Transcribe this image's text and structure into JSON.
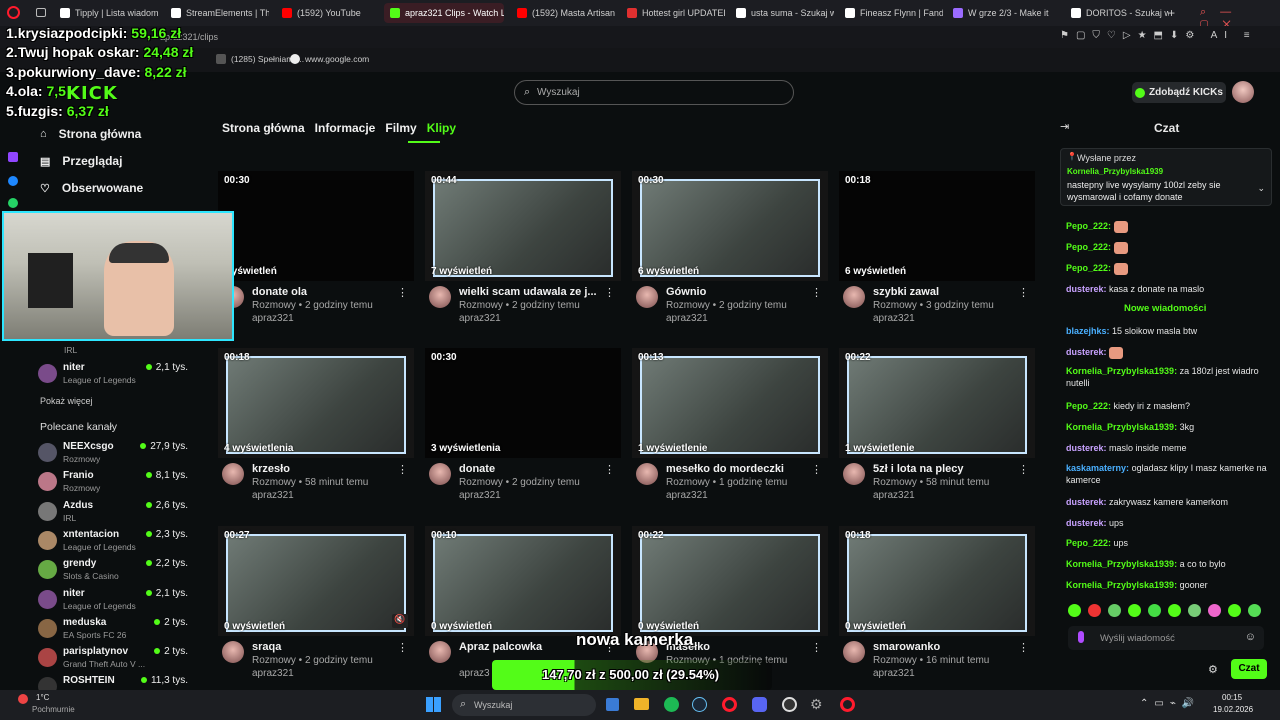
{
  "browser": {
    "tabs": [
      {
        "label": "Tipply | Lista wiadom",
        "color": "#ffffff"
      },
      {
        "label": "StreamElements | Th",
        "color": "#ffffff"
      },
      {
        "label": "(1592) YouTube",
        "color": "#ff0000"
      },
      {
        "label": "apraz321 Clips - Watch Li",
        "color": "#53fc18",
        "active": true
      },
      {
        "label": "(1592) Masta Artisan",
        "color": "#ff0000"
      },
      {
        "label": "Hottest girl UPDATED",
        "color": "#e03030"
      },
      {
        "label": "usta suma - Szukaj w",
        "color": "#ffffff"
      },
      {
        "label": "Fineasz Flynn | Fand",
        "color": "#ffffff"
      },
      {
        "label": "W grze 2/3 - Make it",
        "color": "#9b6bff"
      },
      {
        "label": "DORITOS - Szukaj w",
        "color": "#ffffff"
      }
    ],
    "address_fragment": "apraz321/clips",
    "bookmarks": [
      "(1285) Spełniamy...",
      "www.google.com"
    ]
  },
  "stream_overlay": {
    "leaderboard": [
      {
        "rank": "1.",
        "name": "krysiazpodcipki:",
        "amount": "59,16 zł"
      },
      {
        "rank": "2.",
        "name": "Twuj hopak oskar:",
        "amount": "24,48 zł"
      },
      {
        "rank": "3.",
        "name": "pokurwiony_dave:",
        "amount": "8,22 zł"
      },
      {
        "rank": "4.",
        "name": "ola:",
        "amount": "7,5"
      },
      {
        "rank": "5.",
        "name": "fuzgis:",
        "amount": "6,37 zł"
      }
    ],
    "logo": "KICK",
    "camera_label": "nowa kamerka",
    "goal_text": "147,70 zł z 500,00 zł (29.54%)",
    "goal_fraction": 0.2954
  },
  "header": {
    "search_placeholder": "Wyszukaj",
    "kicks_button": "Zdobądź KICKs"
  },
  "sidebar": {
    "nav": [
      {
        "label": "Strona główna",
        "icon": "home-icon"
      },
      {
        "label": "Przeglądaj",
        "icon": "browse-icon"
      },
      {
        "label": "Obserwowane",
        "icon": "heart-icon"
      }
    ],
    "followed": [
      {
        "name": "niter",
        "category": "League of Legends",
        "viewers": "2,1 tys."
      }
    ],
    "followed_tag": "IRL",
    "show_more": "Pokaż więcej",
    "recommended_title": "Polecane kanały",
    "recommended": [
      {
        "name": "NEEXcsgo",
        "category": "Rozmowy",
        "viewers": "27,9 tys."
      },
      {
        "name": "Franio",
        "category": "Rozmowy",
        "viewers": "8,1 tys."
      },
      {
        "name": "Azdus",
        "category": "IRL",
        "viewers": "2,6 tys."
      },
      {
        "name": "xntentacion",
        "category": "League of Legends",
        "viewers": "2,3 tys."
      },
      {
        "name": "grendy",
        "category": "Slots & Casino",
        "viewers": "2,2 tys."
      },
      {
        "name": "niter",
        "category": "League of Legends",
        "viewers": "2,1 tys."
      },
      {
        "name": "meduska",
        "category": "EA Sports FC 26",
        "viewers": "2 tys."
      },
      {
        "name": "parisplatynov",
        "category": "Grand Theft Auto V ...",
        "viewers": "2 tys."
      },
      {
        "name": "ROSHTEIN",
        "category": "",
        "viewers": "11,3 tys."
      }
    ]
  },
  "channel_tabs": [
    {
      "label": "Strona główna"
    },
    {
      "label": "Informacje"
    },
    {
      "label": "Filmy"
    },
    {
      "label": "Klipy",
      "active": true
    }
  ],
  "clips": [
    {
      "duration": "00:30",
      "views": "wyświetleń",
      "title": "donate ola",
      "category": "Rozmowy",
      "time": "2 godziny temu",
      "channel": "apraz321",
      "dark": true
    },
    {
      "duration": "00:44",
      "views": "7 wyświetleń",
      "title": "wielki scam udawala ze j...",
      "category": "Rozmowy",
      "time": "2 godziny temu",
      "channel": "apraz321"
    },
    {
      "duration": "00:30",
      "views": "6 wyświetleń",
      "title": "Gównio",
      "category": "Rozmowy",
      "time": "2 godziny temu",
      "channel": "apraz321"
    },
    {
      "duration": "00:18",
      "views": "6 wyświetleń",
      "title": "szybki zawal",
      "category": "Rozmowy",
      "time": "3 godziny temu",
      "channel": "apraz321",
      "dark": true
    },
    {
      "duration": "00:18",
      "views": "4 wyświetlenia",
      "title": "krzesło",
      "category": "Rozmowy",
      "time": "58 minut temu",
      "channel": "apraz321"
    },
    {
      "duration": "00:30",
      "views": "3 wyświetlenia",
      "title": "donate",
      "category": "Rozmowy",
      "time": "2 godziny temu",
      "channel": "apraz321",
      "dark": true
    },
    {
      "duration": "00:13",
      "views": "1 wyświetlenie",
      "title": "mesełko do mordeczki",
      "category": "Rozmowy",
      "time": "1 godzinę temu",
      "channel": "apraz321"
    },
    {
      "duration": "00:22",
      "views": "1 wyświetlenie",
      "title": "5zł i lota na plecy",
      "category": "Rozmowy",
      "time": "58 minut temu",
      "channel": "apraz321"
    },
    {
      "duration": "00:27",
      "views": "0 wyświetleń",
      "title": "sraqa",
      "category": "Rozmowy",
      "time": "2 godziny temu",
      "channel": "apraz321"
    },
    {
      "duration": "00:10",
      "views": "0 wyświetleń",
      "title": "Apraz palcowka",
      "category": "",
      "time": "",
      "channel": "apraz3",
      "dark": false
    },
    {
      "duration": "00:22",
      "views": "0 wyświetleń",
      "title": "masełko",
      "category": "Rozmowy",
      "time": "1 godzinę temu",
      "channel": "",
      "dark": false
    },
    {
      "duration": "00:18",
      "views": "0 wyświetleń",
      "title": "smarowanko",
      "category": "Rozmowy",
      "time": "16 minut temu",
      "channel": "apraz321"
    }
  ],
  "chat": {
    "title": "Czat",
    "pinned_label": "Wysłane przez",
    "pinned_user": "Kornelia_Przybylska1939",
    "pinned_text": "nastepny live wysylamy 100zl zeby sie wysmarowal i cofamy donate",
    "new_messages": "Nowe wiadomości",
    "messages": [
      {
        "user": "Pepo_222:",
        "text": "",
        "color": "#53fc18"
      },
      {
        "user": "Pepo_222:",
        "text": "",
        "color": "#53fc18"
      },
      {
        "user": "Pepo_222:",
        "text": "",
        "color": "#53fc18"
      },
      {
        "user": "dusterek:",
        "text": "kasa z donate na maslo",
        "color": "#c8a2ff"
      },
      {
        "user": "blazejhks:",
        "text": "15 sloikow masla btw",
        "color": "#4ab0ff"
      },
      {
        "user": "dusterek:",
        "text": "",
        "color": "#c8a2ff"
      },
      {
        "user": "Kornelia_Przybylska1939:",
        "text": "za 180zl jest wiadro nutelli",
        "color": "#53fc18"
      },
      {
        "user": "Pepo_222:",
        "text": "kiedy iri z masłem?",
        "color": "#53fc18"
      },
      {
        "user": "Kornelia_Przybylska1939:",
        "text": "3kg",
        "color": "#53fc18"
      },
      {
        "user": "dusterek:",
        "text": "maslo inside meme",
        "color": "#c8a2ff"
      },
      {
        "user": "kaskamaterny:",
        "text": "ogladasz klipy I masz kamerke na kamerce",
        "color": "#4ab0ff"
      },
      {
        "user": "dusterek:",
        "text": "zakrywasz kamere kamerkom",
        "color": "#c8a2ff"
      },
      {
        "user": "dusterek:",
        "text": "ups",
        "color": "#c8a2ff"
      },
      {
        "user": "Pepo_222:",
        "text": "ups",
        "color": "#53fc18"
      },
      {
        "user": "Kornelia_Przybylska1939:",
        "text": "a co to bylo",
        "color": "#53fc18"
      },
      {
        "user": "Kornelia_Przybylska1939:",
        "text": "gooner",
        "color": "#53fc18"
      }
    ],
    "input_placeholder": "Wyślij wiadomość",
    "send_label": "Czat"
  },
  "taskbar": {
    "weather_temp": "1°C",
    "weather_desc": "Pochmurnie",
    "search_placeholder": "Wyszukaj",
    "time": "00:15",
    "date": "19.02.2026"
  },
  "colors": {
    "accent": "#53fc18",
    "webcam_border": "#2ee6ff"
  }
}
